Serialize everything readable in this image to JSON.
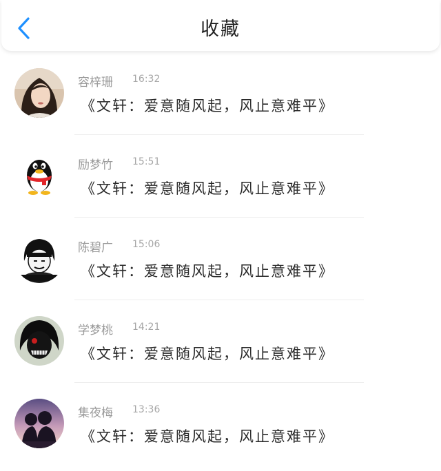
{
  "header": {
    "title": "收藏",
    "back_icon": "chevron-left-icon",
    "accent_color": "#1e90ff"
  },
  "items": [
    {
      "name": "容梓珊",
      "time": "16:32",
      "message": "《文轩：爱意随风起，风止意难平》",
      "avatar": "girl-portrait-avatar"
    },
    {
      "name": "励梦竹",
      "time": "15:51",
      "message": "《文轩：爱意随风起，风止意难平》",
      "avatar": "qq-penguin-avatar"
    },
    {
      "name": "陈碧广",
      "time": "15:06",
      "message": "《文轩：爱意随风起，风止意难平》",
      "avatar": "meme-face-avatar"
    },
    {
      "name": "学梦桃",
      "time": "14:21",
      "message": "《文轩：爱意随风起，风止意难平》",
      "avatar": "anime-mask-avatar"
    },
    {
      "name": "集夜梅",
      "time": "13:36",
      "message": "《文轩：爱意随风起，风止意难平》",
      "avatar": "sunset-couple-avatar"
    }
  ]
}
